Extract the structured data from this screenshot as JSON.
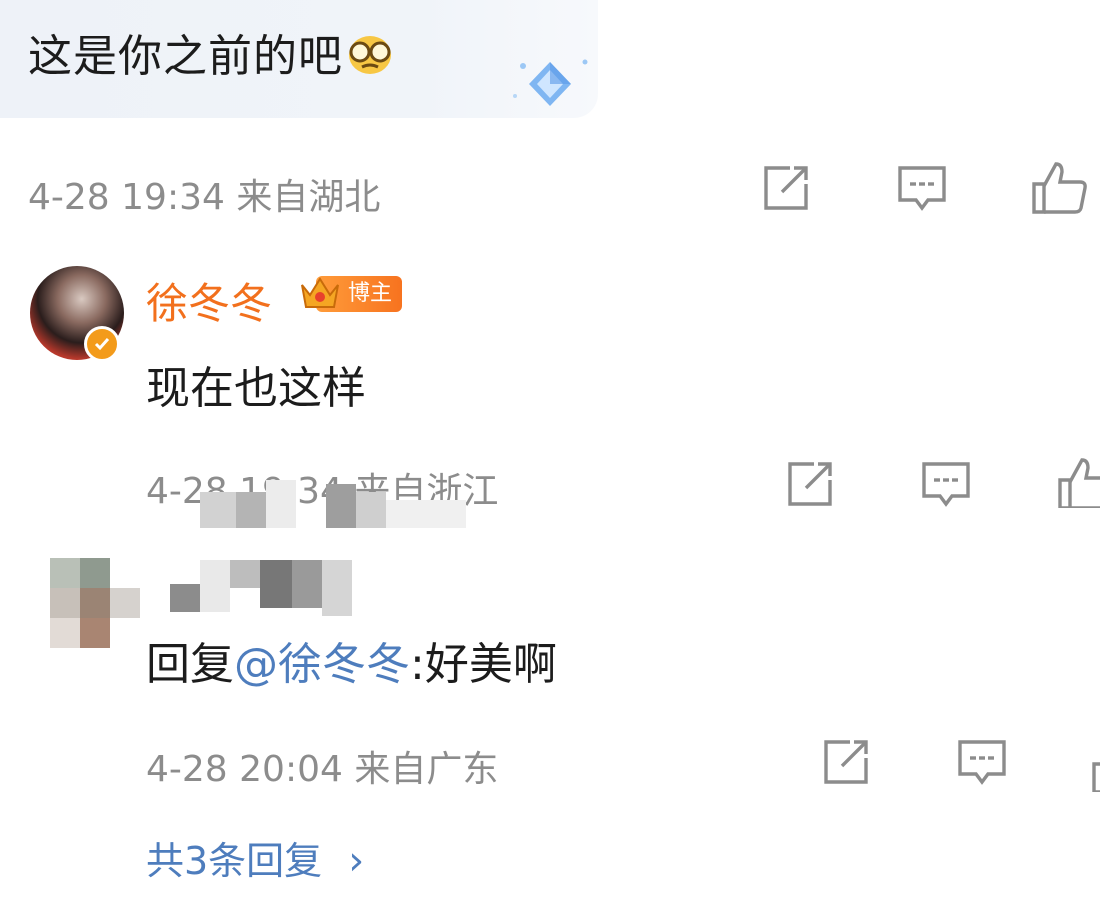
{
  "top_comment": {
    "text": "这是你之前的吧",
    "emoji_icon": "glasses-face-emoji-icon",
    "meta": "4-28 19:34 来自湖北",
    "actions": [
      "share-icon",
      "comment-icon",
      "like-icon"
    ]
  },
  "author_reply": {
    "name": "徐冬冬",
    "badge": "博主",
    "text": "现在也这样",
    "meta": "4-28 19:34 来自浙江"
  },
  "user_reply": {
    "prefix": "回复",
    "mention": "@徐冬冬",
    "text": ":好美啊",
    "meta": "4-28 20:04 来自广东"
  },
  "more_replies": {
    "label": "共3条回复",
    "chevron": "›"
  },
  "colors": {
    "author_orange": "#f2701d",
    "link_blue": "#4e7dbd",
    "meta_gray": "#8c8c8c"
  }
}
